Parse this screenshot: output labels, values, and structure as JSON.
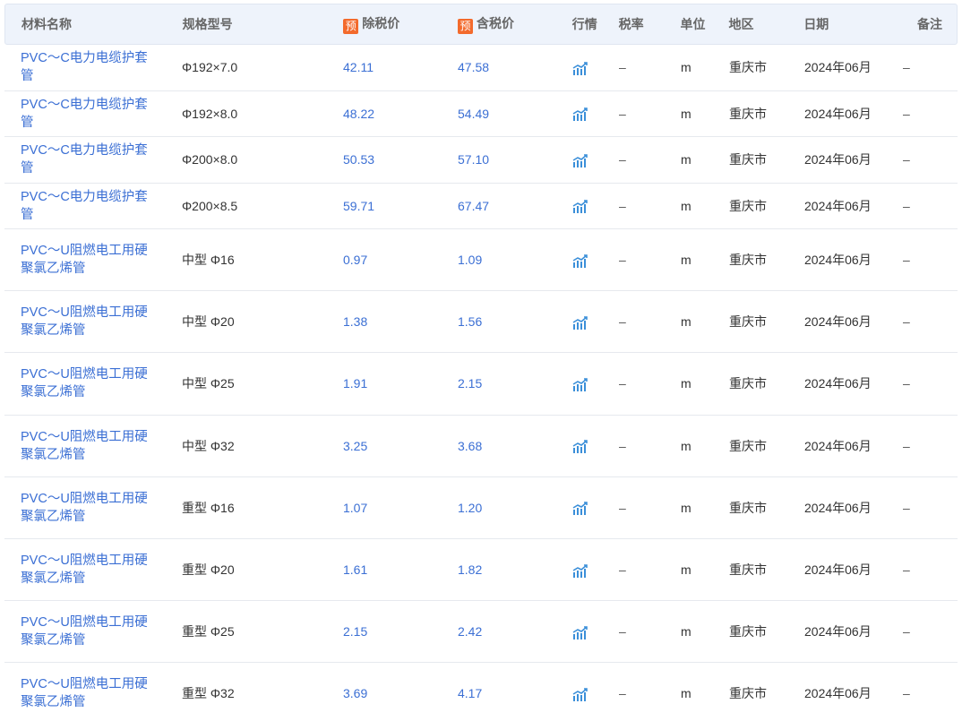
{
  "header": {
    "name": "材料名称",
    "spec": "规格型号",
    "price_ex_badge": "预",
    "price_ex": "除税价",
    "price_in_badge": "预",
    "price_in": "含税价",
    "trend": "行情",
    "tax": "税率",
    "unit": "单位",
    "region": "地区",
    "date": "日期",
    "note": "备注"
  },
  "icons": {
    "trend": "trend-chart-icon"
  },
  "colors": {
    "link": "#3b6fd4",
    "badge": "#f36a2c",
    "header_bg": "#eef3fb"
  },
  "rows": [
    {
      "name": "PVC～C电力电缆护套管",
      "spec": "Φ192×7.0",
      "price_ex": "42.11",
      "price_in": "47.58",
      "tax": "–",
      "unit": "m",
      "region": "重庆市",
      "date": "2024年06月",
      "note": "–"
    },
    {
      "name": "PVC～C电力电缆护套管",
      "spec": "Φ192×8.0",
      "price_ex": "48.22",
      "price_in": "54.49",
      "tax": "–",
      "unit": "m",
      "region": "重庆市",
      "date": "2024年06月",
      "note": "–"
    },
    {
      "name": "PVC～C电力电缆护套管",
      "spec": "Φ200×8.0",
      "price_ex": "50.53",
      "price_in": "57.10",
      "tax": "–",
      "unit": "m",
      "region": "重庆市",
      "date": "2024年06月",
      "note": "–"
    },
    {
      "name": "PVC～C电力电缆护套管",
      "spec": "Φ200×8.5",
      "price_ex": "59.71",
      "price_in": "67.47",
      "tax": "–",
      "unit": "m",
      "region": "重庆市",
      "date": "2024年06月",
      "note": "–"
    },
    {
      "name": "PVC～U阻燃电工用硬聚氯乙烯管",
      "spec": "中型 Φ16",
      "price_ex": "0.97",
      "price_in": "1.09",
      "tax": "–",
      "unit": "m",
      "region": "重庆市",
      "date": "2024年06月",
      "note": "–"
    },
    {
      "name": "PVC～U阻燃电工用硬聚氯乙烯管",
      "spec": "中型 Φ20",
      "price_ex": "1.38",
      "price_in": "1.56",
      "tax": "–",
      "unit": "m",
      "region": "重庆市",
      "date": "2024年06月",
      "note": "–"
    },
    {
      "name": "PVC～U阻燃电工用硬聚氯乙烯管",
      "spec": "中型 Φ25",
      "price_ex": "1.91",
      "price_in": "2.15",
      "tax": "–",
      "unit": "m",
      "region": "重庆市",
      "date": "2024年06月",
      "note": "–"
    },
    {
      "name": "PVC～U阻燃电工用硬聚氯乙烯管",
      "spec": "中型 Φ32",
      "price_ex": "3.25",
      "price_in": "3.68",
      "tax": "–",
      "unit": "m",
      "region": "重庆市",
      "date": "2024年06月",
      "note": "–"
    },
    {
      "name": "PVC～U阻燃电工用硬聚氯乙烯管",
      "spec": "重型 Φ16",
      "price_ex": "1.07",
      "price_in": "1.20",
      "tax": "–",
      "unit": "m",
      "region": "重庆市",
      "date": "2024年06月",
      "note": "–"
    },
    {
      "name": "PVC～U阻燃电工用硬聚氯乙烯管",
      "spec": "重型 Φ20",
      "price_ex": "1.61",
      "price_in": "1.82",
      "tax": "–",
      "unit": "m",
      "region": "重庆市",
      "date": "2024年06月",
      "note": "–"
    },
    {
      "name": "PVC～U阻燃电工用硬聚氯乙烯管",
      "spec": "重型 Φ25",
      "price_ex": "2.15",
      "price_in": "2.42",
      "tax": "–",
      "unit": "m",
      "region": "重庆市",
      "date": "2024年06月",
      "note": "–"
    },
    {
      "name": "PVC～U阻燃电工用硬聚氯乙烯管",
      "spec": "重型 Φ32",
      "price_ex": "3.69",
      "price_in": "4.17",
      "tax": "–",
      "unit": "m",
      "region": "重庆市",
      "date": "2024年06月",
      "note": "–"
    }
  ]
}
